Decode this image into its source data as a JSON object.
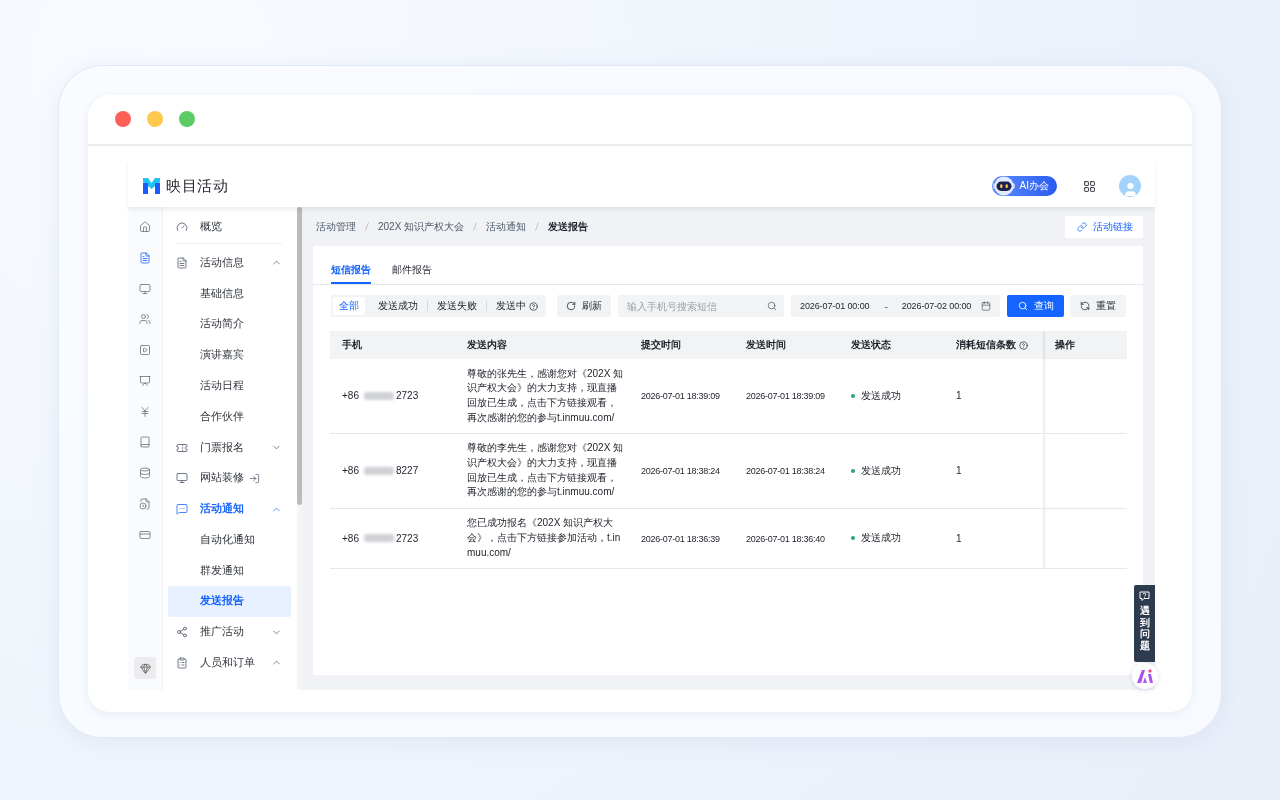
{
  "app": {
    "logo": "映目活动",
    "ai_badge": "AI办会"
  },
  "rail": [
    {
      "selected": false
    },
    {
      "selected": true
    },
    {
      "selected": false
    },
    {
      "selected": false
    },
    {
      "selected": false
    },
    {
      "selected": false
    },
    {
      "selected": false
    },
    {
      "selected": false
    },
    {
      "selected": false
    },
    {
      "selected": false
    },
    {
      "selected": false
    }
  ],
  "sidebar": {
    "items": [
      {
        "kind": "link",
        "label": "概览",
        "active": false
      },
      {
        "kind": "group",
        "label": "活动信息",
        "active": false,
        "expanded": true,
        "children": [
          {
            "label": "基础信息",
            "selected": false
          },
          {
            "label": "活动简介",
            "selected": false
          },
          {
            "label": "演讲嘉宾",
            "selected": false
          },
          {
            "label": "活动日程",
            "selected": false
          },
          {
            "label": "合作伙伴",
            "selected": false
          }
        ]
      },
      {
        "kind": "group",
        "label": "门票报名",
        "active": false,
        "expanded": false
      },
      {
        "kind": "external",
        "label": "网站装修",
        "active": false
      },
      {
        "kind": "group",
        "label": "活动通知",
        "active": true,
        "expanded": true,
        "children": [
          {
            "label": "自动化通知",
            "selected": false
          },
          {
            "label": "群发通知",
            "selected": false
          },
          {
            "label": "发送报告",
            "selected": true
          }
        ]
      },
      {
        "kind": "group",
        "label": "推广活动",
        "active": false,
        "expanded": false
      },
      {
        "kind": "group",
        "label": "人员和订单",
        "active": false,
        "expanded": true
      }
    ]
  },
  "breadcrumb": [
    "活动管理",
    "202X 知识产权大会",
    "活动通知",
    "发送报告"
  ],
  "link_button": "活动链接",
  "tabs": [
    {
      "label": "短信报告",
      "selected": true
    },
    {
      "label": "邮件报告",
      "selected": false
    }
  ],
  "filters": {
    "status_options": [
      {
        "label": "全部",
        "selected": true,
        "help": false
      },
      {
        "label": "发送成功",
        "selected": false,
        "help": false
      },
      {
        "label": "发送失败",
        "selected": false,
        "help": false
      },
      {
        "label": "发送中",
        "selected": false,
        "help": true
      }
    ],
    "refresh_button": "刷新",
    "search": {
      "placeholder": "输入手机号搜索短信"
    },
    "date_range": {
      "start": "2026-07-01 00:00",
      "separator": "-",
      "end": "2026-07-02 00:00"
    },
    "query_button": "查询",
    "reset_button": "重置"
  },
  "table": {
    "columns": [
      {
        "label": "手机",
        "help": false
      },
      {
        "label": "发送内容",
        "help": false
      },
      {
        "label": "提交时间",
        "help": false
      },
      {
        "label": "发送时间",
        "help": false
      },
      {
        "label": "发送状态",
        "help": false
      },
      {
        "label": "消耗短信条数",
        "help": true
      },
      {
        "label": "操作",
        "help": false
      }
    ],
    "rows": [
      {
        "phone_prefix": "+86",
        "phone_suffix": "2723",
        "content": "尊敬的张先生，感谢您对《202X 知识产权大会》的大力支持，现直播回放已生成，点击下方链接观看，再次感谢的您的参与t.inmuu.com/",
        "submitted": "2026-07-01 18:39:09",
        "sent": "2026-07-01 18:39:09",
        "status": {
          "text": "发送成功",
          "color": "#2ba471"
        },
        "count": "1"
      },
      {
        "phone_prefix": "+86",
        "phone_suffix": "8227",
        "content": "尊敬的李先生，感谢您对《202X 知识产权大会》的大力支持，现直播回放已生成，点击下方链接观看，再次感谢的您的参与t.inmuu.com/",
        "submitted": "2026-07-01 18:38:24",
        "sent": "2026-07-01 18:38:24",
        "status": {
          "text": "发送成功",
          "color": "#2ba471"
        },
        "count": "1"
      },
      {
        "phone_prefix": "+86",
        "phone_suffix": "2723",
        "content": "您已成功报名《202X 知识产权大会》，点击下方链接参加活动，t.inmuu.com/",
        "submitted": "2026-07-01 18:36:39",
        "sent": "2026-07-01 18:36:40",
        "status": {
          "text": "发送成功",
          "color": "#2ba471"
        },
        "count": "1"
      }
    ]
  },
  "help_float": "遇到问题"
}
